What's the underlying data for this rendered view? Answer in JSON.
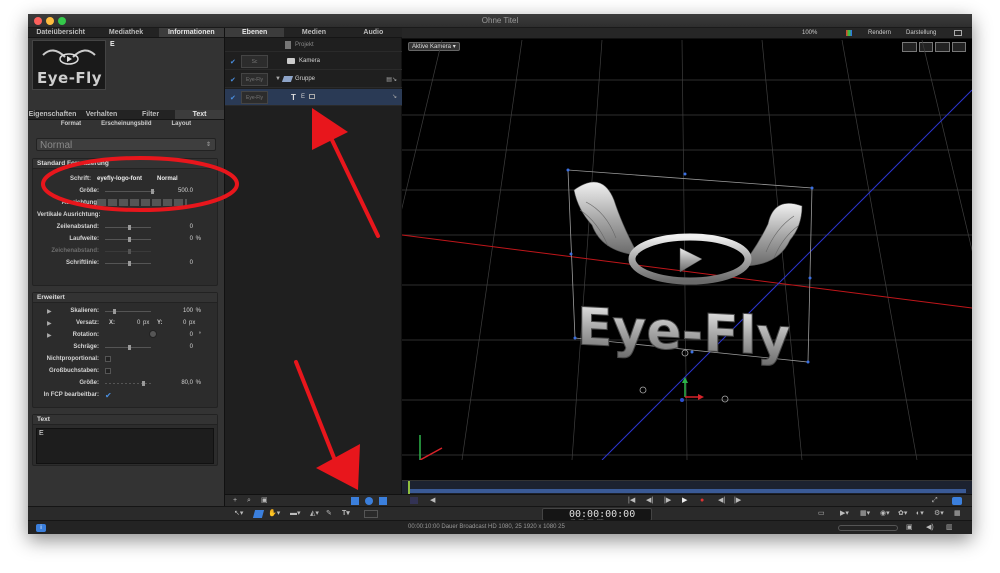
{
  "window": {
    "title": "Ohne Titel",
    "traffic_colors": [
      "#fc605c",
      "#fdbc40",
      "#34c84a"
    ]
  },
  "inspector": {
    "top_tabs": [
      "Dateiübersicht",
      "Mediathek",
      "Informationen"
    ],
    "preview_name": "E",
    "preview_logo_text": "Eye-Fly",
    "sub_tabs": [
      "Eigenschaften",
      "Verhalten",
      "Filter",
      "Text"
    ],
    "text_tabs": [
      "Format",
      "Erscheinungsbild",
      "Layout"
    ],
    "preset": "Normal",
    "standard": {
      "title": "Standard Formatierung",
      "font_label": "Schrift:",
      "font_value": "eyefly-logo-font",
      "font_style": "Normal",
      "size_label": "Größe:",
      "size_value": "500.0",
      "align_label": "Ausrichtung:",
      "vertical_label": "Vertikale Ausrichtung:",
      "line_spacing_label": "Zeilenabstand:",
      "line_spacing_value": "0",
      "tracking_label": "Laufweite:",
      "tracking_value": "0",
      "tracking_unit": "%",
      "kerning_label": "Zeichenabstand:",
      "baseline_label": "Schriftlinie:",
      "baseline_value": "0"
    },
    "advanced": {
      "title": "Erweitert",
      "scale_label": "Skalieren:",
      "scale_value": "100",
      "scale_unit": "%",
      "offset_label": "Versatz:",
      "offset_x_label": "X:",
      "offset_x": "0",
      "offset_x_unit": "px",
      "offset_y_label": "Y:",
      "offset_y": "0",
      "offset_y_unit": "px",
      "rotation_label": "Rotation:",
      "rotation_value": "0",
      "rotation_unit": "°",
      "slant_label": "Schräge:",
      "slant_value": "0",
      "monospace_label": "Nichtproportional:",
      "allcaps_label": "Großbuchstaben:",
      "caps_size_label": "Größe:",
      "caps_size_value": "80,0",
      "caps_size_unit": "%",
      "fcp_label": "In FCP bearbeitbar:"
    },
    "text_section": {
      "title": "Text",
      "content": "E"
    }
  },
  "layers": {
    "tabs": [
      "Ebenen",
      "Medien",
      "Audio"
    ],
    "items": [
      {
        "name": "Projekt",
        "indent": 0
      },
      {
        "name": "Kamera",
        "indent": 0
      },
      {
        "name": "Gruppe",
        "indent": 0
      },
      {
        "name": "E",
        "indent": 1
      }
    ]
  },
  "viewer": {
    "camera": "Aktive Kamera",
    "zoom": "100%",
    "render": "Rendern",
    "display": "Darstellung",
    "logo_text": "Eye-Fly"
  },
  "toolbar": {
    "timecode": "00:00:00:00",
    "timecode_sub": "HR    MIN    SEK    FRM"
  },
  "status": {
    "info": "00:00:10:00 Dauer Broadcast HD 1080, 25 1920 x 1080 25"
  },
  "colors": {
    "accent": "#3b7fdc",
    "red_annotation": "#e8161c",
    "panel": "#333333",
    "viewer_bg": "#000000"
  }
}
